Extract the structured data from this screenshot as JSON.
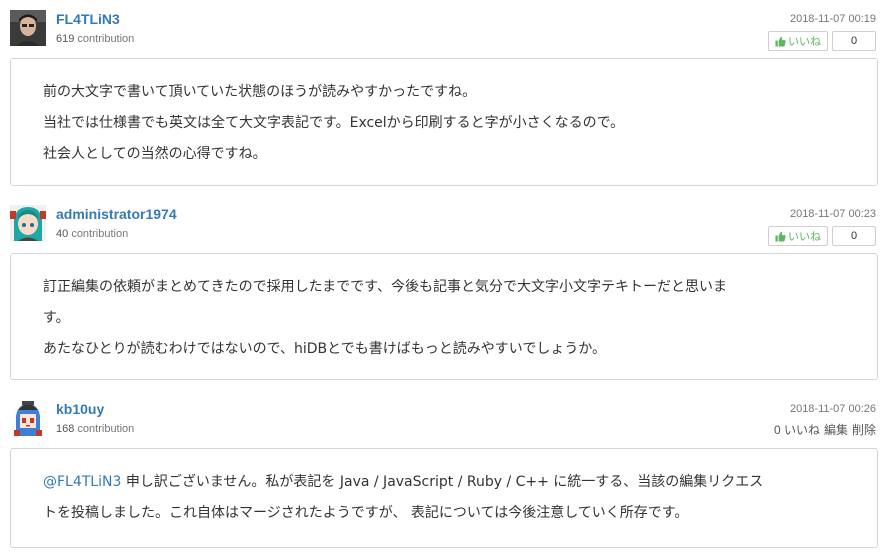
{
  "comments": [
    {
      "user": "FL4TLiN3",
      "contribution_count": "619",
      "contribution_word": "contribution",
      "date": "2018-11-07 00:19",
      "like_label": "いいね",
      "like_count": "0",
      "avatar_icon": "user-avatar-photo",
      "lines": [
        "前の大文字で書いて頂いていた状態のほうが読みやすかったですね。",
        "当社では仕様書でも英文は全て大文字表記です。Excelから印刷すると字が小さくなるので。",
        "社会人としての当然の心得ですね。"
      ]
    },
    {
      "user": "administrator1974",
      "contribution_count": "40",
      "contribution_word": "contribution",
      "date": "2018-11-07 00:23",
      "like_label": "いいね",
      "like_count": "0",
      "avatar_icon": "user-avatar-anime",
      "lines": [
        "訂正編集の依頼がまとめてきたので採用したまでです、今後も記事と気分で大文字小文字テキトーだと思いま",
        "す。",
        "あたなひとりが読むわけではないので、hiDBとでも書けばもっと読みやすいでしょうか。"
      ]
    },
    {
      "user": "kb10uy",
      "contribution_count": "168",
      "contribution_word": "contribution",
      "date": "2018-11-07 00:26",
      "likes_text": "0 いいね",
      "edit_label": "編集",
      "delete_label": "削除",
      "avatar_icon": "user-avatar-pixel",
      "mention": "@FL4TLiN3",
      "lines": [
        " 申し訳ございません。私が表記を Java / JavaScript / Ruby / C++ に統一する、当該の編集リクエス",
        "トを投稿しました。これ自体はマージされたようですが、 表記については今後注意していく所存です。"
      ]
    }
  ],
  "colors": {
    "username": "#337ab7",
    "like_green": "#5cb85c",
    "border": "#d6d6d6"
  }
}
